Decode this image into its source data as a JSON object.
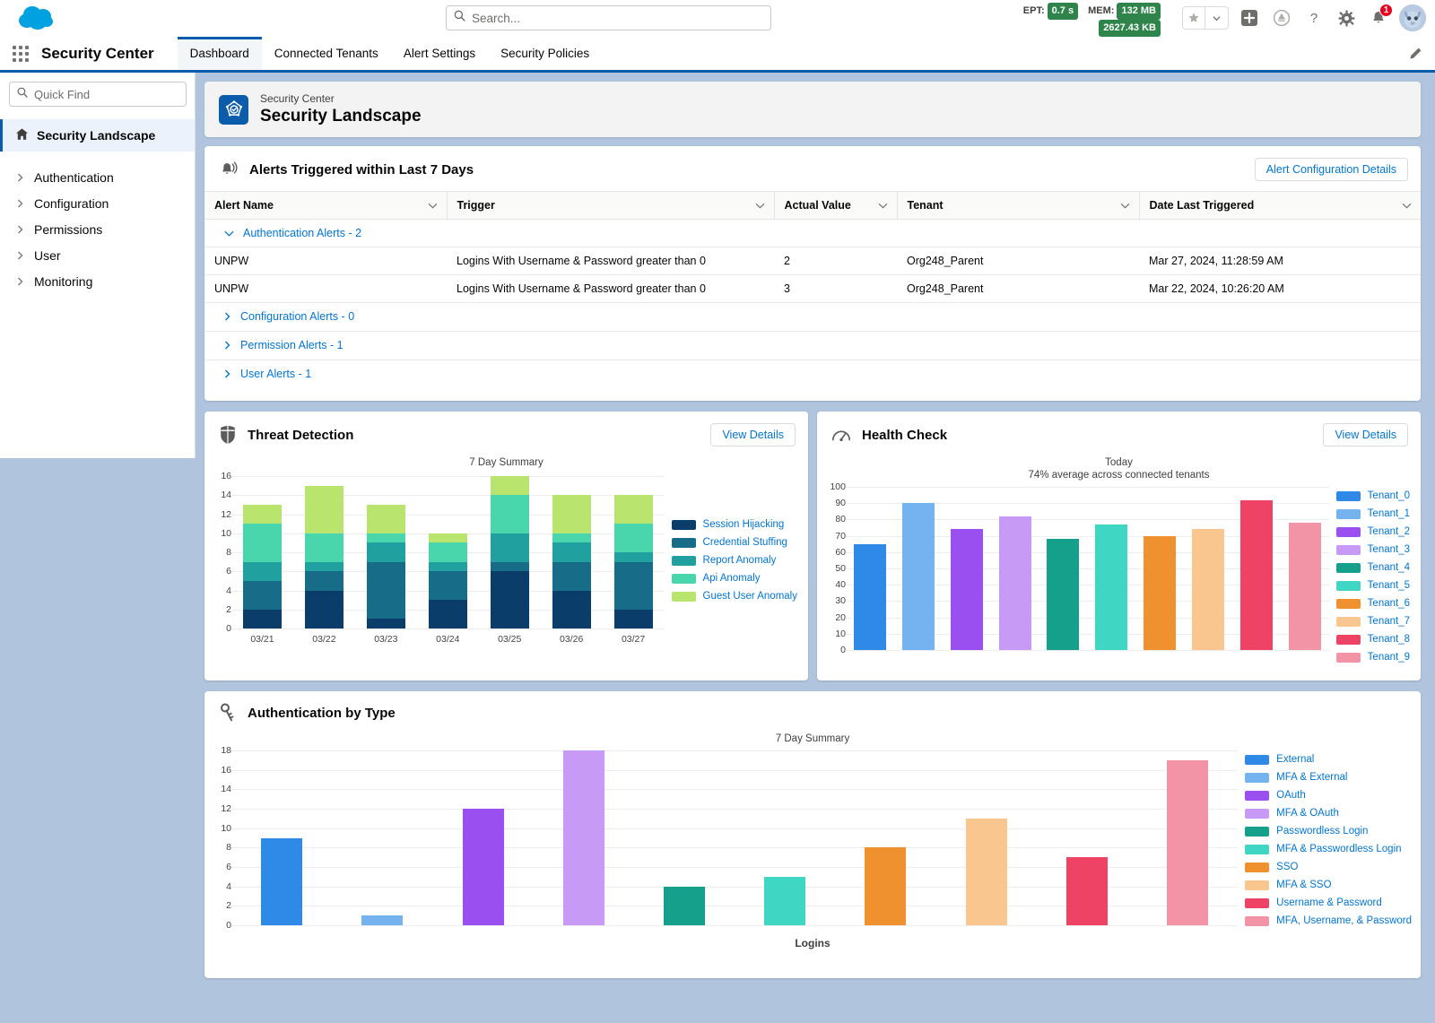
{
  "header": {
    "search_placeholder": "Search...",
    "perf": {
      "ept_label": "EPT:",
      "ept_value": "0.7 s",
      "mem_label": "MEM:",
      "mem_value": "132 MB",
      "kb_value": "2627.43 KB"
    },
    "notification_count": "1"
  },
  "appnav": {
    "app_name": "Security Center",
    "tabs": [
      {
        "label": "Dashboard",
        "active": true
      },
      {
        "label": "Connected Tenants",
        "active": false
      },
      {
        "label": "Alert Settings",
        "active": false
      },
      {
        "label": "Security Policies",
        "active": false
      }
    ]
  },
  "sidebar": {
    "quick_find_placeholder": "Quick Find",
    "active_item": "Security Landscape",
    "items": [
      {
        "label": "Authentication"
      },
      {
        "label": "Configuration"
      },
      {
        "label": "Permissions"
      },
      {
        "label": "User"
      },
      {
        "label": "Monitoring"
      }
    ]
  },
  "page_header": {
    "subtitle": "Security Center",
    "title": "Security Landscape"
  },
  "alerts": {
    "title": "Alerts Triggered within Last 7 Days",
    "button": "Alert Configuration Details",
    "columns": [
      "Alert Name",
      "Trigger",
      "Actual Value",
      "Tenant",
      "Date Last Triggered"
    ],
    "groups": [
      {
        "label": "Authentication Alerts - 2",
        "expanded": true,
        "rows": [
          {
            "name": "UNPW",
            "trigger": "Logins With Username & Password greater than 0",
            "actual": "2",
            "tenant": "Org248_Parent",
            "date": "Mar 27, 2024, 11:28:59 AM"
          },
          {
            "name": "UNPW",
            "trigger": "Logins With Username & Password greater than 0",
            "actual": "3",
            "tenant": "Org248_Parent",
            "date": "Mar 22, 2024, 10:26:20 AM"
          }
        ]
      },
      {
        "label": "Configuration Alerts - 0",
        "expanded": false,
        "rows": []
      },
      {
        "label": "Permission Alerts - 1",
        "expanded": false,
        "rows": []
      },
      {
        "label": "User Alerts - 1",
        "expanded": false,
        "rows": []
      }
    ]
  },
  "threat_card": {
    "title": "Threat Detection",
    "button": "View Details"
  },
  "health_card": {
    "title": "Health Check",
    "button": "View Details"
  },
  "auth_card": {
    "title": "Authentication by Type"
  },
  "chart_data": [
    {
      "id": "threat_detection",
      "type": "bar",
      "stacked": true,
      "title": "7 Day Summary",
      "xlabel": "",
      "ylabel": "",
      "ylim": [
        0,
        16
      ],
      "yticks": [
        0,
        2,
        4,
        6,
        8,
        10,
        12,
        14,
        16
      ],
      "grid": true,
      "legend_position": "right",
      "categories": [
        "03/21",
        "03/22",
        "03/23",
        "03/24",
        "03/25",
        "03/26",
        "03/27"
      ],
      "series": [
        {
          "name": "Session Hijacking",
          "color": "#0b3d6b",
          "values": [
            2,
            4,
            1,
            3,
            6,
            4,
            2
          ]
        },
        {
          "name": "Credential Stuffing",
          "color": "#176c87",
          "values": [
            3,
            2,
            6,
            3,
            1,
            3,
            5
          ]
        },
        {
          "name": "Report Anomaly",
          "color": "#21a0a0",
          "values": [
            2,
            1,
            2,
            1,
            3,
            2,
            1
          ]
        },
        {
          "name": "Api Anomaly",
          "color": "#4ad6ad",
          "values": [
            4,
            3,
            1,
            2,
            4,
            1,
            3
          ]
        },
        {
          "name": "Guest User Anomaly",
          "color": "#b9e56e",
          "values": [
            2,
            5,
            3,
            1,
            2,
            4,
            3
          ]
        }
      ],
      "totals": [
        13,
        15,
        13,
        10,
        16,
        14,
        14
      ]
    },
    {
      "id": "health_check",
      "type": "bar",
      "stacked": false,
      "title": "Today",
      "subtitle": "74% average across connected tenants",
      "average": 74,
      "xlabel": "",
      "ylabel": "",
      "ylim": [
        0,
        100
      ],
      "yticks": [
        0,
        10,
        20,
        30,
        40,
        50,
        60,
        70,
        80,
        90,
        100
      ],
      "grid": true,
      "legend_position": "right",
      "categories": [
        "Tenant_0",
        "Tenant_1",
        "Tenant_2",
        "Tenant_3",
        "Tenant_4",
        "Tenant_5",
        "Tenant_6",
        "Tenant_7",
        "Tenant_8",
        "Tenant_9"
      ],
      "values": [
        65,
        90,
        74,
        82,
        68,
        77,
        70,
        74,
        92,
        78
      ],
      "colors": [
        "#2e8ae6",
        "#74b3ef",
        "#9a4ff0",
        "#c79af5",
        "#14a08a",
        "#3fd6c3",
        "#f0912f",
        "#fac68f",
        "#ee4364",
        "#f294a6"
      ]
    },
    {
      "id": "authentication_by_type",
      "type": "bar",
      "stacked": false,
      "title": "7 Day Summary",
      "xlabel": "Logins",
      "ylabel": "",
      "ylim": [
        0,
        18
      ],
      "yticks": [
        0,
        2,
        4,
        6,
        8,
        10,
        12,
        14,
        16,
        18
      ],
      "grid": true,
      "legend_position": "right",
      "categories": [
        "External",
        "MFA & External",
        "OAuth",
        "MFA & OAuth",
        "Passwordless Login",
        "MFA & Passwordless Login",
        "SSO",
        "MFA & SSO",
        "Username & Password",
        "MFA, Username, & Password"
      ],
      "values": [
        9,
        1,
        12,
        18,
        4,
        5,
        8,
        11,
        7,
        17
      ],
      "colors": [
        "#2e8ae6",
        "#74b3ef",
        "#9a4ff0",
        "#c79af5",
        "#14a08a",
        "#3fd6c3",
        "#f0912f",
        "#fac68f",
        "#ee4364",
        "#f294a6"
      ]
    }
  ]
}
